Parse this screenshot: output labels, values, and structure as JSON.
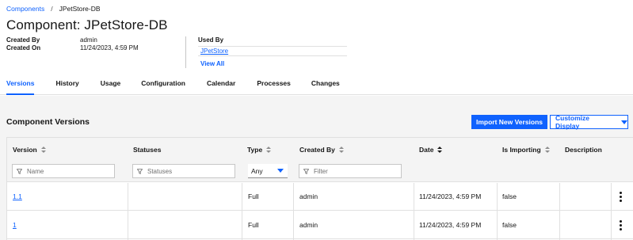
{
  "breadcrumb": {
    "parent": "Components",
    "separator": "/",
    "current": "JPetStore-DB"
  },
  "page_title": "Component: JPetStore-DB",
  "meta": {
    "created_by_label": "Created By",
    "created_by": "admin",
    "created_on_label": "Created On",
    "created_on": "11/24/2023, 4:59 PM"
  },
  "used_by": {
    "label": "Used By",
    "item": "JPetStore",
    "view_all": "View All"
  },
  "tabs": [
    "Versions",
    "History",
    "Usage",
    "Configuration",
    "Calendar",
    "Processes",
    "Changes"
  ],
  "active_tab": "Versions",
  "section": {
    "title": "Component Versions",
    "import_button": "Import New Versions",
    "customize_button": "Customize Display"
  },
  "table": {
    "columns": [
      "Version",
      "Statuses",
      "Type",
      "Created By",
      "Date",
      "Is Importing",
      "Description"
    ],
    "filters": {
      "version_placeholder": "Name",
      "statuses_placeholder": "Statuses",
      "type_value": "Any",
      "created_by_placeholder": "Filter"
    },
    "rows": [
      {
        "version": "1.1",
        "statuses": "",
        "type": "Full",
        "created_by": "admin",
        "date": "11/24/2023, 4:59 PM",
        "is_importing": "false",
        "description": ""
      },
      {
        "version": "1",
        "statuses": "",
        "type": "Full",
        "created_by": "admin",
        "date": "11/24/2023, 4:59 PM",
        "is_importing": "false",
        "description": ""
      }
    ]
  },
  "colors": {
    "accent": "#0f62fe",
    "panel": "#f4f4f4",
    "border": "#e0e0e0"
  },
  "icons": [
    "sort-icon",
    "filter-icon",
    "chevron-down-icon",
    "overflow-menu-icon"
  ]
}
